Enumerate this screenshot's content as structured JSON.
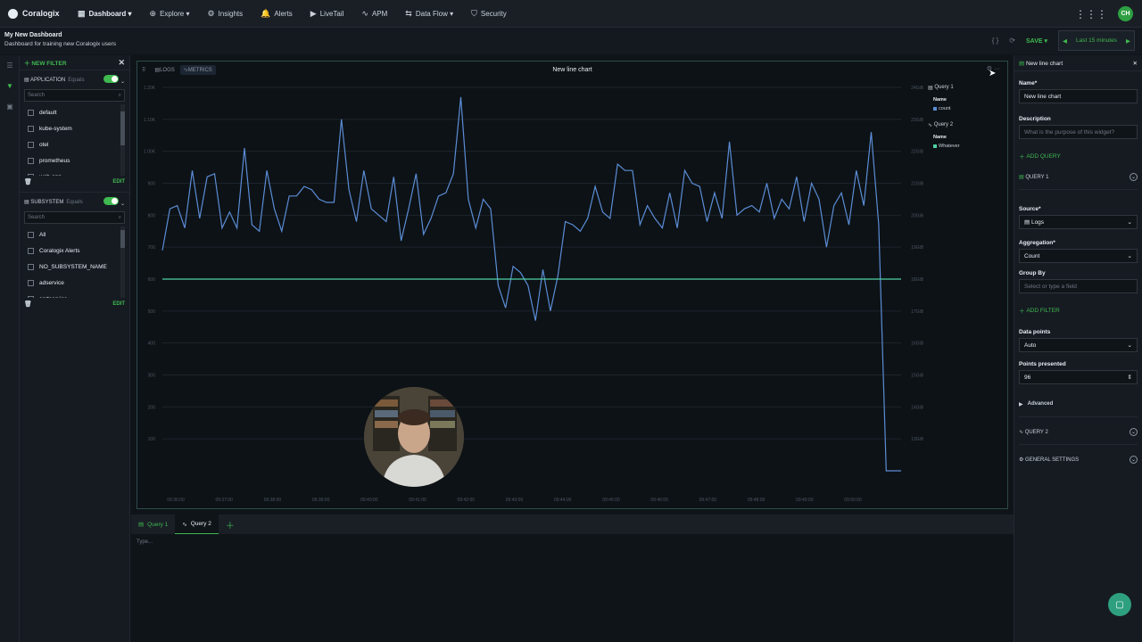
{
  "topnav": {
    "brand": "Coralogix",
    "items": [
      {
        "label": "Dashboard ▾",
        "icon": "▦"
      },
      {
        "label": "Explore ▾",
        "icon": "⊕"
      },
      {
        "label": "Insights",
        "icon": "⚙"
      },
      {
        "label": "Alerts",
        "icon": "🔔"
      },
      {
        "label": "LiveTail",
        "icon": "▶"
      },
      {
        "label": "APM",
        "icon": "∿"
      },
      {
        "label": "Data Flow ▾",
        "icon": "⇆"
      },
      {
        "label": "Security",
        "icon": "⛉"
      }
    ],
    "avatar": "CH"
  },
  "dashboard": {
    "title": "My New Dashboard",
    "description": "Dashboard for training new Coralogix users",
    "save_label": "SAVE ▾",
    "timerange": "Last 15 minutes"
  },
  "filters": {
    "new_filter_label": "NEW FILTER",
    "application": {
      "label": "APPLICATION",
      "operator": "Equals",
      "search_placeholder": "Search",
      "items": [
        "default",
        "kube-system",
        "otel",
        "prometheus",
        "web-app"
      ],
      "edit_label": "EDIT"
    },
    "subsystem": {
      "label": "SUBSYSTEM",
      "operator": "Equals",
      "search_placeholder": "Search",
      "items": [
        "All",
        "Coralogix Alerts",
        "NO_SUBSYSTEM_NAME",
        "adservice",
        "cartservice"
      ],
      "edit_label": "EDIT"
    }
  },
  "widget": {
    "title": "New line chart",
    "tabs": [
      "LOGS",
      "METRICS"
    ],
    "legend": {
      "query1_label": "Query 1",
      "query1_name_header": "Name",
      "query1_series": "count",
      "query2_label": "Query 2",
      "query2_name_header": "Name",
      "query2_series": "Whatever"
    }
  },
  "chart_data": {
    "type": "line",
    "title": "New line chart",
    "x_ticks": [
      "09:36:00",
      "09:37:00",
      "09:38:00",
      "09:39:00",
      "09:40:00",
      "09:41:00",
      "09:42:00",
      "09:43:00",
      "09:44:00",
      "09:45:00",
      "09:46:00",
      "09:47:00",
      "09:48:00",
      "09:49:00",
      "09:50:00"
    ],
    "y_left_ticks": [
      "100",
      "200",
      "300",
      "400",
      "500",
      "600",
      "700",
      "800",
      "900",
      "1.00K",
      "1.10K",
      "1.20K"
    ],
    "y_right_ticks": [
      "13GiB",
      "14GiB",
      "15GiB",
      "16GiB",
      "17GiB",
      "18GiB",
      "19GiB",
      "20GiB",
      "21GiB",
      "22GiB",
      "23GiB",
      "24GiB"
    ],
    "ylim_left": [
      0,
      1200
    ],
    "series": [
      {
        "name": "count",
        "color": "#5b8dd6",
        "values": [
          690,
          820,
          830,
          760,
          940,
          790,
          920,
          930,
          760,
          810,
          760,
          1010,
          770,
          750,
          940,
          820,
          750,
          860,
          860,
          890,
          880,
          850,
          840,
          840,
          1100,
          880,
          780,
          940,
          820,
          800,
          780,
          920,
          720,
          820,
          930,
          740,
          790,
          860,
          870,
          930,
          1170,
          850,
          760,
          850,
          820,
          580,
          510,
          640,
          620,
          580,
          470,
          630,
          500,
          610,
          780,
          770,
          750,
          790,
          890,
          810,
          790,
          960,
          940,
          940,
          770,
          830,
          790,
          760,
          870,
          760,
          940,
          900,
          890,
          780,
          870,
          790,
          1030,
          800,
          820,
          830,
          810,
          900,
          790,
          850,
          820,
          920,
          780,
          900,
          850,
          700,
          830,
          870,
          770,
          940,
          830,
          1060,
          770,
          0,
          0,
          0
        ]
      },
      {
        "name": "Whatever",
        "color": "#4fd1a5",
        "values_right_gib": [
          18,
          18,
          18,
          18,
          18,
          18,
          18,
          18,
          18,
          18,
          18,
          18,
          18,
          18,
          18,
          18,
          18,
          18,
          18,
          18,
          18,
          18,
          18,
          18,
          18,
          18,
          18,
          18,
          18,
          18,
          18,
          18,
          18,
          18,
          18,
          18,
          18,
          18,
          18,
          18,
          18,
          18,
          18,
          18,
          18,
          18,
          18,
          18,
          18,
          18,
          18,
          18,
          18,
          18,
          18,
          18,
          18,
          18,
          18,
          18,
          18,
          18,
          18,
          18,
          18,
          18,
          18,
          18,
          18,
          18,
          18,
          18,
          18,
          18,
          18,
          18,
          18,
          18,
          18,
          18,
          18,
          18,
          18,
          18,
          18,
          18,
          18,
          18,
          18,
          18,
          18,
          18,
          18,
          18,
          18,
          18,
          18,
          18,
          18,
          18
        ]
      }
    ]
  },
  "query_bar": {
    "tabs": [
      "Query 1",
      "Query 2"
    ],
    "editor_placeholder": "Type..."
  },
  "settings": {
    "header": "New line chart",
    "name_label": "Name*",
    "name_value": "New line chart",
    "description_label": "Description",
    "description_placeholder": "What is the purpose of this widget?",
    "add_query": "ADD QUERY",
    "query1": "QUERY 1",
    "source_label": "Source*",
    "source_value": "Logs",
    "aggregation_label": "Aggregation*",
    "aggregation_value": "Count",
    "groupby_label": "Group By",
    "groupby_placeholder": "Select or type a field",
    "add_filter": "ADD FILTER",
    "datapoints_label": "Data points",
    "datapoints_value": "Auto",
    "points_label": "Points presented",
    "points_value": "96",
    "advanced": "Advanced",
    "query2": "QUERY 2",
    "general": "GENERAL SETTINGS"
  }
}
